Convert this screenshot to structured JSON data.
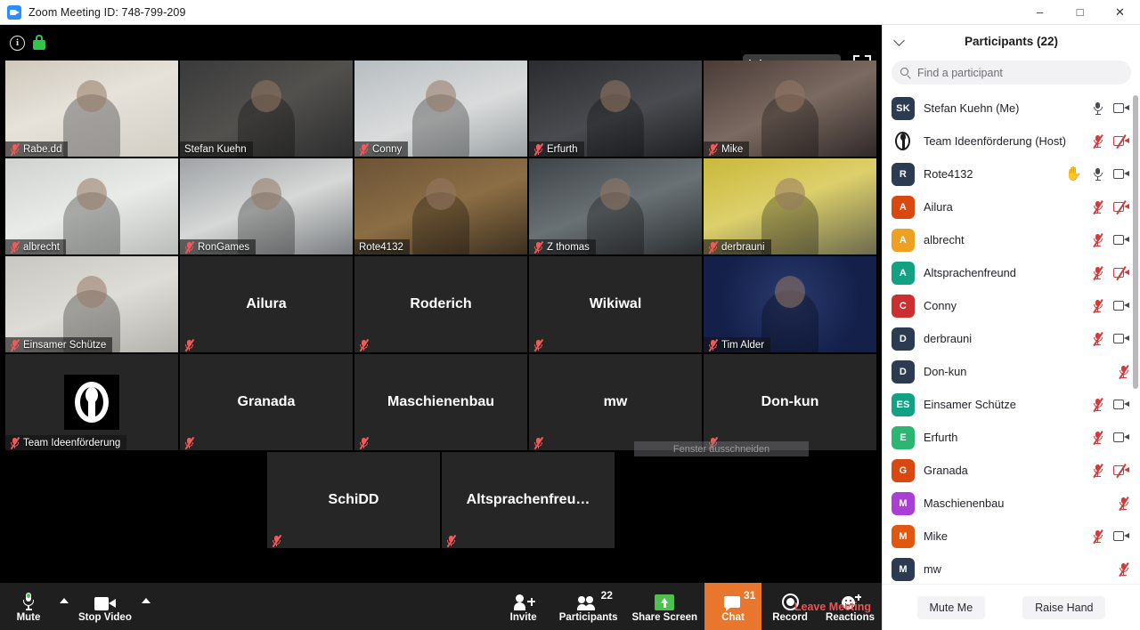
{
  "window": {
    "title": "Zoom Meeting ID: 748-799-209",
    "app_icon": "zoom-video-icon",
    "minimize": "–",
    "maximize": "□",
    "close": "✕"
  },
  "stage": {
    "info_icon": "i",
    "lock_icon": "encryption-lock-icon",
    "view_button": {
      "label": "Speaker View",
      "icon": "layout-icon"
    },
    "fullscreen_button": {
      "icon": "fullscreen-icon"
    },
    "snip_overlay": "Fenster ausschneiden"
  },
  "grid": {
    "rows": [
      [
        {
          "name": "Rabe.dd",
          "muted": true,
          "video": true,
          "active": false,
          "bg": "bg1"
        },
        {
          "name": "Stefan Kuehn",
          "muted": false,
          "video": true,
          "active": true,
          "bg": "bg2"
        },
        {
          "name": "Conny",
          "muted": true,
          "video": true,
          "active": false,
          "bg": "bg3"
        },
        {
          "name": "Erfurth",
          "muted": true,
          "video": true,
          "active": false,
          "bg": "bg4"
        },
        {
          "name": "Mike",
          "muted": true,
          "video": true,
          "active": false,
          "bg": "bg5"
        }
      ],
      [
        {
          "name": "albrecht",
          "muted": true,
          "video": true,
          "active": false,
          "bg": "bg6"
        },
        {
          "name": "RonGames",
          "muted": true,
          "video": true,
          "active": false,
          "bg": "bg7"
        },
        {
          "name": "Rote4132",
          "muted": false,
          "video": true,
          "active": false,
          "bg": "bg8"
        },
        {
          "name": "Z thomas",
          "muted": true,
          "video": true,
          "active": false,
          "bg": "bg9"
        },
        {
          "name": "derbrauni",
          "muted": true,
          "video": true,
          "active": false,
          "bg": "bg10"
        }
      ],
      [
        {
          "name": "Einsamer Schütze",
          "muted": true,
          "video": true,
          "active": false,
          "bg": "bg11"
        },
        {
          "name": "Ailura",
          "muted": true,
          "video": false,
          "active": false,
          "bg": ""
        },
        {
          "name": "Roderich",
          "muted": true,
          "video": false,
          "active": false,
          "bg": ""
        },
        {
          "name": "Wikiwal",
          "muted": true,
          "video": false,
          "active": false,
          "bg": ""
        },
        {
          "name": "Tim Alder",
          "muted": true,
          "video": true,
          "active": false,
          "bg": "bg12"
        }
      ],
      [
        {
          "name": "Team Ideenförderung",
          "muted": true,
          "video": false,
          "active": false,
          "bg": "",
          "logo": true
        },
        {
          "name": "Granada",
          "muted": true,
          "video": false,
          "active": false,
          "bg": ""
        },
        {
          "name": "Maschienenbau",
          "muted": true,
          "video": false,
          "active": false,
          "bg": ""
        },
        {
          "name": "mw",
          "muted": true,
          "video": false,
          "active": false,
          "bg": ""
        },
        {
          "name": "Don-kun",
          "muted": true,
          "video": false,
          "active": false,
          "bg": ""
        }
      ],
      [
        {
          "name": "SchiDD",
          "muted": true,
          "video": false,
          "active": false,
          "bg": ""
        },
        {
          "name": "Altsprachenfreu…",
          "muted": true,
          "video": false,
          "active": false,
          "bg": ""
        }
      ]
    ]
  },
  "toolbar": {
    "mute": {
      "label": "Mute",
      "icon": "microphone-icon"
    },
    "mute_caret": "audio-options-caret-icon",
    "stop_video": {
      "label": "Stop Video",
      "icon": "camera-icon"
    },
    "video_caret": "video-options-caret-icon",
    "invite": {
      "label": "Invite",
      "icon": "add-person-icon"
    },
    "participants": {
      "label": "Participants",
      "icon": "people-icon",
      "count": "22"
    },
    "share_screen": {
      "label": "Share Screen",
      "icon": "share-screen-icon"
    },
    "chat": {
      "label": "Chat",
      "icon": "chat-bubble-icon",
      "count": "31"
    },
    "record": {
      "label": "Record",
      "icon": "record-icon"
    },
    "reactions": {
      "label": "Reactions",
      "icon": "smiley-plus-icon"
    },
    "leave": "Leave Meeting"
  },
  "panel": {
    "title": "Participants (22)",
    "collapse_icon": "chevron-down-icon",
    "search": {
      "placeholder": "Find a participant",
      "value": "",
      "icon": "search-icon"
    },
    "mute_me": "Mute Me",
    "raise_hand": "Raise Hand",
    "participants": [
      {
        "initials": "SK",
        "name": "Stefan Kuehn (Me)",
        "color": "#2d3b52",
        "mic": "on",
        "cam": "on",
        "hand": false,
        "logo": false
      },
      {
        "initials": "",
        "name": "Team Ideenförderung (Host)",
        "color": "#ffffff",
        "mic": "off",
        "cam": "off",
        "hand": false,
        "logo": true
      },
      {
        "initials": "R",
        "name": "Rote4132",
        "color": "#2d3b52",
        "mic": "on",
        "cam": "on",
        "hand": true,
        "logo": false
      },
      {
        "initials": "A",
        "name": "Ailura",
        "color": "#d9480f",
        "mic": "off",
        "cam": "off",
        "hand": false,
        "logo": false
      },
      {
        "initials": "A",
        "name": "albrecht",
        "color": "#f0a020",
        "mic": "off",
        "cam": "on",
        "hand": false,
        "logo": false
      },
      {
        "initials": "A",
        "name": "Altsprachenfreund",
        "color": "#12a183",
        "mic": "off",
        "cam": "off",
        "hand": false,
        "logo": false
      },
      {
        "initials": "C",
        "name": "Conny",
        "color": "#cc2f2f",
        "mic": "off",
        "cam": "on",
        "hand": false,
        "logo": false
      },
      {
        "initials": "D",
        "name": "derbrauni",
        "color": "#2d3b52",
        "mic": "off",
        "cam": "on",
        "hand": false,
        "logo": false
      },
      {
        "initials": "D",
        "name": "Don-kun",
        "color": "#2d3b52",
        "mic": "off",
        "cam": "none",
        "hand": false,
        "logo": false
      },
      {
        "initials": "ES",
        "name": "Einsamer Schütze",
        "color": "#12a183",
        "mic": "off",
        "cam": "on",
        "hand": false,
        "logo": false
      },
      {
        "initials": "E",
        "name": "Erfurth",
        "color": "#2bb673",
        "mic": "off",
        "cam": "on",
        "hand": false,
        "logo": false
      },
      {
        "initials": "G",
        "name": "Granada",
        "color": "#d9480f",
        "mic": "off",
        "cam": "off",
        "hand": false,
        "logo": false
      },
      {
        "initials": "M",
        "name": "Maschienenbau",
        "color": "#a93fd4",
        "mic": "off",
        "cam": "none",
        "hand": false,
        "logo": false
      },
      {
        "initials": "M",
        "name": "Mike",
        "color": "#e2570f",
        "mic": "off",
        "cam": "on",
        "hand": false,
        "logo": false
      },
      {
        "initials": "M",
        "name": "mw",
        "color": "#2d3b52",
        "mic": "off",
        "cam": "none",
        "hand": false,
        "logo": false
      }
    ]
  }
}
